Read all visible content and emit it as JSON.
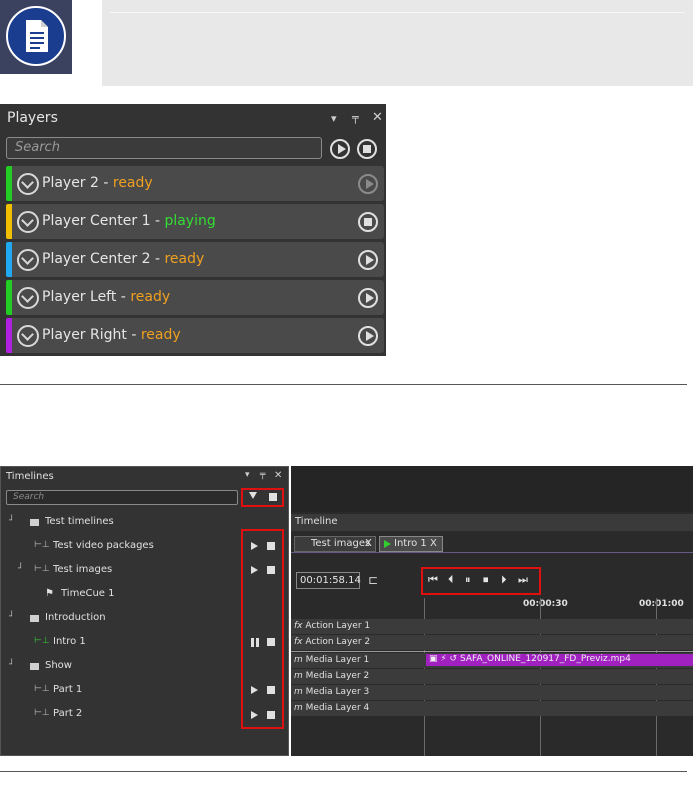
{
  "players_panel": {
    "title": "Players",
    "search_placeholder": "Search",
    "players": [
      {
        "name": "Player 2 - ",
        "status": "ready",
        "bar_color": "#22cc22",
        "status_color": "#f0a020",
        "action": "play-disabled"
      },
      {
        "name": "Player Center 1 - ",
        "status": "playing",
        "bar_color": "#f0c000",
        "status_color": "#33dd33",
        "action": "stop"
      },
      {
        "name": "Player Center 2 - ",
        "status": "ready",
        "bar_color": "#20a8f0",
        "status_color": "#f0a020",
        "action": "play"
      },
      {
        "name": "Player Left - ",
        "status": "ready",
        "bar_color": "#22cc22",
        "status_color": "#f0a020",
        "action": "play"
      },
      {
        "name": "Player Right - ",
        "status": "ready",
        "bar_color": "#b020e0",
        "status_color": "#f0a020",
        "action": "play"
      }
    ]
  },
  "timelines_panel": {
    "title": "Timelines",
    "search_placeholder": "Search",
    "items": [
      {
        "label": "Test timelines",
        "type": "folder"
      },
      {
        "label": "Test video packages",
        "type": "timeline",
        "control": "play"
      },
      {
        "label": "Test images",
        "type": "timeline",
        "control": "play"
      },
      {
        "label": "TimeCue 1",
        "type": "cue"
      },
      {
        "label": "Introduction",
        "type": "folder"
      },
      {
        "label": "Intro 1",
        "type": "timeline-active",
        "control": "pause"
      },
      {
        "label": "Show",
        "type": "folder"
      },
      {
        "label": "Part 1",
        "type": "timeline",
        "control": "play"
      },
      {
        "label": "Part 2",
        "type": "timeline",
        "control": "play"
      }
    ]
  },
  "timeline_view": {
    "header": "Timeline",
    "tabs": [
      {
        "label": "Test images",
        "close": "X"
      },
      {
        "label": "Intro 1",
        "close": "X"
      }
    ],
    "current_time": "00:01:58.14",
    "ruler": [
      "00:00:30",
      "00:01:00"
    ],
    "layers": [
      {
        "prefix": "fx",
        "label": "Action Layer 1"
      },
      {
        "prefix": "fx",
        "label": "Action Layer 2"
      },
      {
        "prefix": "m",
        "label": "Media Layer 1"
      },
      {
        "prefix": "m",
        "label": "Media Layer 2"
      },
      {
        "prefix": "m",
        "label": "Media Layer 3"
      },
      {
        "prefix": "m",
        "label": "Media Layer 4"
      }
    ],
    "clip": "SAFA_ONLINE_120917_FD_Previz.mp4"
  },
  "colors": {
    "highlight": "#e01010",
    "clip": "#a020c0",
    "panel_bg": "#333333"
  }
}
